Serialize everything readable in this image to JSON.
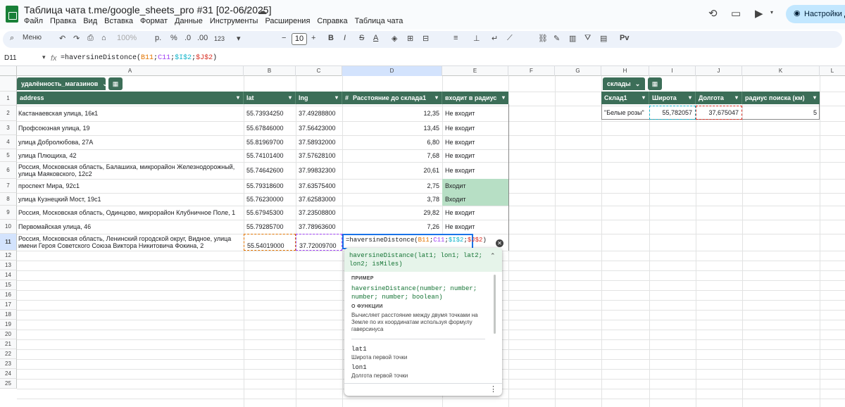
{
  "title": "Таблица чата t.me/google_sheets_pro #31 [02-06/2025]",
  "menu": [
    "Файл",
    "Правка",
    "Вид",
    "Вставка",
    "Формат",
    "Данные",
    "Инструменты",
    "Расширения",
    "Справка",
    "Таблица чата"
  ],
  "share_label": "Настройки Д",
  "toolbar": {
    "search": "Меню",
    "zoom": "100%",
    "currency": "р.",
    "percent": "%",
    "dec_dec": ".0",
    "inc_dec": ".00",
    "format123": "123",
    "font_size": "10",
    "bold": "B",
    "italic": "I",
    "strike": "S",
    "text_color": "A",
    "rv": "Рv"
  },
  "formula_bar": {
    "cell_ref": "D11",
    "fx": "fx",
    "formula_prefix": "=haversineDistonce(",
    "ref1": "B11",
    "sep1": ";",
    "ref2": "C11",
    "sep2": ";",
    "ref3": "$I$2",
    "sep3": ";",
    "ref4": "$J$2",
    "formula_suffix": ")"
  },
  "columns": [
    "A",
    "B",
    "C",
    "D",
    "E",
    "F",
    "G",
    "H",
    "I",
    "J",
    "K",
    "L"
  ],
  "rows": [
    "1",
    "2",
    "3",
    "4",
    "5",
    "6",
    "7",
    "8",
    "9",
    "10",
    "11",
    "12",
    "13",
    "14",
    "15",
    "16",
    "17",
    "18",
    "19",
    "20",
    "21",
    "22",
    "23",
    "24",
    "25"
  ],
  "table1": {
    "name": "удалённость_магазинов",
    "headers": [
      "address",
      "lat",
      "lng",
      "Расстояние до склада1",
      "входит в радиус"
    ],
    "rows": [
      [
        "Кастанаевская улица, 16к1",
        "55.73934250",
        "37.49288800",
        "12,35",
        "Не входит"
      ],
      [
        "Профсоюзная улица, 19",
        "55.67846000",
        "37.56423000",
        "13,45",
        "Не входит"
      ],
      [
        "улица Добролюбова, 27А",
        "55.81969700",
        "37.58932000",
        "6,80",
        "Не входит"
      ],
      [
        "улица Плющиха, 42",
        "55.74101400",
        "37.57628100",
        "7,68",
        "Не входит"
      ],
      [
        "Россия, Московская область, Балашиха, микрорайон Железнодорожный, улица Маяковского, 12с2",
        "55.74642600",
        "37.99832300",
        "20,61",
        "Не входит"
      ],
      [
        "проспект Мира, 92с1",
        "55.79318600",
        "37.63575400",
        "2,75",
        "Входит"
      ],
      [
        "улица Кузнецкий Мост, 19с1",
        "55.76230000",
        "37.62583000",
        "3,78",
        "Входит"
      ],
      [
        "Россия, Московская область, Одинцово, микрорайон Клубничное Поле, 1",
        "55.67945300",
        "37.23508800",
        "29,82",
        "Не входит"
      ],
      [
        "Первомайская улица, 46",
        "55.79285700",
        "37.78963600",
        "7,26",
        "Не входит"
      ],
      [
        "Россия, Московская область, Ленинский городской округ, Видное, улица имени Героя Советского Союза Виктора Никитовича Фокина, 2",
        "55.54019000",
        "37.72009700",
        "",
        ""
      ]
    ]
  },
  "table2": {
    "name": "склады",
    "headers": [
      "Склад1",
      "Широта",
      "Долгота",
      "радиус поиска (км)"
    ],
    "row": [
      "\"Белые розы\"",
      "55,782057",
      "37,675047",
      "5"
    ]
  },
  "edit_cell": {
    "prefix": "=haversineDistonce(",
    "ref1": "B11",
    "ref2": "C11",
    "ref3": "$I$2",
    "ref4": "$J$2",
    "suffix": ")"
  },
  "popup": {
    "signature": "haversineDistance(lat1; lon1; lat2; lon2; isMiles)",
    "example_label": "ПРИМЕР",
    "example": "haversineDistance(number; number; number; number; boolean)",
    "about_label": "О ФУНКЦИИ",
    "about": "Вычисляет расстояние между двумя точками на Земле по их координатам используя формулу гаверсинуса",
    "params": [
      {
        "name": "lat1",
        "desc": "Широта первой точки"
      },
      {
        "name": "lon1",
        "desc": "Долгота первой точки"
      }
    ]
  },
  "colors": {
    "table_header": "#3c6e58",
    "in_radius_fill": "#b7dfc5",
    "selection": "#1a73e8"
  }
}
